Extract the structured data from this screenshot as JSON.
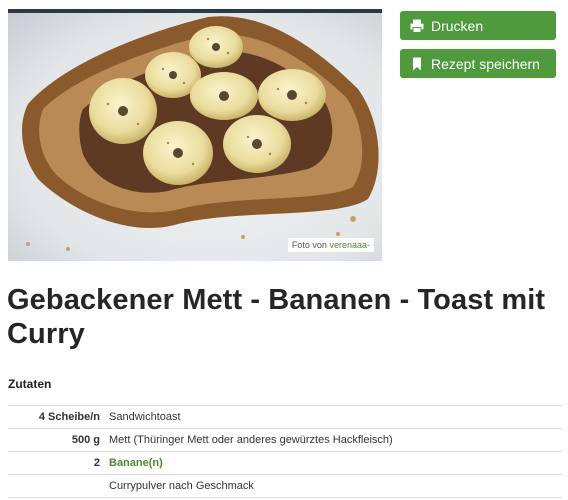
{
  "photo": {
    "credit_prefix": "Foto von",
    "credit_author": "verenaaa-"
  },
  "actions": {
    "print_label": "Drucken",
    "print_icon": "printer-icon",
    "save_label": "Rezept speichern",
    "save_icon": "bookmark-icon",
    "button_color": "#4e9a3d"
  },
  "recipe": {
    "title": "Gebackener Mett - Bananen - Toast mit Curry",
    "ingredients_heading": "Zutaten",
    "ingredients": [
      {
        "amount": "4 Scheibe/n",
        "name": "Sandwichtoast",
        "link": false
      },
      {
        "amount": "500 g",
        "name": "Mett (Thüringer Mett oder anderes gewürztes Hackfleisch)",
        "link": false
      },
      {
        "amount": "2",
        "name": "Banane(n)",
        "link": true
      },
      {
        "amount": "",
        "name": "Currypulver nach Geschmack",
        "link": false
      }
    ],
    "link_color": "#4a8a2f"
  }
}
